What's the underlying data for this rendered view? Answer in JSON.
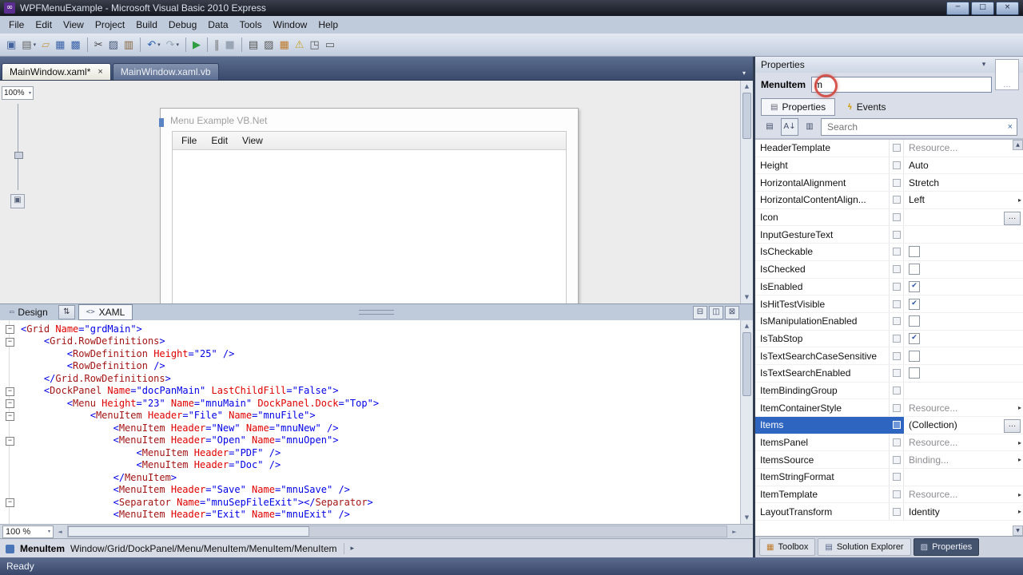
{
  "window": {
    "title": "WPFMenuExample - Microsoft Visual Basic 2010 Express"
  },
  "menu_bar": {
    "items": [
      "File",
      "Edit",
      "View",
      "Project",
      "Build",
      "Debug",
      "Data",
      "Tools",
      "Window",
      "Help"
    ]
  },
  "toolbar": {
    "groups": [
      [
        {
          "name": "new-project",
          "glyph": "▣",
          "color": "#44639E"
        },
        {
          "name": "add-new-item",
          "glyph": "▤",
          "color": "#666666",
          "dropdown": true
        },
        {
          "name": "open-file",
          "glyph": "▱",
          "color": "#C89B4A"
        },
        {
          "name": "save",
          "glyph": "▦",
          "color": "#3A62A8"
        },
        {
          "name": "save-all",
          "glyph": "▩",
          "color": "#3A62A8"
        }
      ],
      [
        {
          "name": "cut",
          "glyph": "✂",
          "color": "#444444"
        },
        {
          "name": "copy",
          "glyph": "▨",
          "color": "#445577"
        },
        {
          "name": "paste",
          "glyph": "▥",
          "color": "#86643C"
        }
      ],
      [
        {
          "name": "undo",
          "glyph": "↶",
          "color": "#2B5FB0",
          "dropdown": true
        },
        {
          "name": "redo",
          "glyph": "↷",
          "color": "#9AAABB",
          "dropdown": true
        }
      ],
      [
        {
          "name": "start-debugging",
          "glyph": "▶",
          "color": "#2E9E40"
        }
      ],
      [
        {
          "name": "break-all",
          "glyph": "‖",
          "color": "#777777"
        },
        {
          "name": "stop-debugging",
          "glyph": "■",
          "color": "#9AA5B5"
        }
      ],
      [
        {
          "name": "solution-explorer",
          "glyph": "▤",
          "color": "#555555"
        },
        {
          "name": "properties-window",
          "glyph": "▨",
          "color": "#555555"
        },
        {
          "name": "toolbox",
          "glyph": "▦",
          "color": "#C07A2A"
        },
        {
          "name": "error-list",
          "glyph": "⚠",
          "color": "#C9A227"
        },
        {
          "name": "object-browser",
          "glyph": "◳",
          "color": "#555555"
        },
        {
          "name": "immediate-window",
          "glyph": "▭",
          "color": "#555555"
        }
      ]
    ]
  },
  "doc_tabs": {
    "tabs": [
      {
        "label": "MainWindow.xaml*",
        "active": true
      },
      {
        "label": "MainWindow.xaml.vb",
        "active": false
      }
    ]
  },
  "designer": {
    "zoom": "100%",
    "window_title": "Menu Example VB.Net",
    "menu_items": [
      "File",
      "Edit",
      "View"
    ]
  },
  "editor_split": {
    "design_tab": "Design",
    "xaml_tab": "XAML"
  },
  "xaml": {
    "zoom": "100 %",
    "lines": [
      {
        "text": "<Grid Name=\"grdMain\">",
        "fold": true
      },
      {
        "text": "    <Grid.RowDefinitions>",
        "fold": true
      },
      {
        "text": "        <RowDefinition Height=\"25\" />"
      },
      {
        "text": "        <RowDefinition />"
      },
      {
        "text": "    </Grid.RowDefinitions>"
      },
      {
        "text": "    <DockPanel Name=\"docPanMain\" LastChildFill=\"False\">",
        "fold": true
      },
      {
        "text": "        <Menu Height=\"23\" Name=\"mnuMain\" DockPanel.Dock=\"Top\">",
        "fold": true
      },
      {
        "text": "            <MenuItem Header=\"File\" Name=\"mnuFile\">",
        "fold": true
      },
      {
        "text": "                <MenuItem Header=\"New\" Name=\"mnuNew\" />"
      },
      {
        "text": "                <MenuItem Header=\"Open\" Name=\"mnuOpen\">",
        "fold": true
      },
      {
        "text": "                    <MenuItem Header=\"PDF\" />"
      },
      {
        "text": "                    <MenuItem Header=\"Doc\" />"
      },
      {
        "text": "                </MenuItem>"
      },
      {
        "text": "                <MenuItem Header=\"Save\" Name=\"mnuSave\" />"
      },
      {
        "text": "                <Separator Name=\"mnuSepFileExit\"></Separator>",
        "fold": true
      },
      {
        "text": "                <MenuItem Header=\"Exit\" Name=\"mnuExit\" />"
      }
    ]
  },
  "properties_panel": {
    "title": "Properties",
    "object_type": "MenuItem",
    "object_name": "m",
    "tabs": [
      "Properties",
      "Events"
    ],
    "search_placeholder": "Search",
    "rows": [
      {
        "name": "HeaderTemplate",
        "value": "Resource...",
        "muted": true,
        "arrow": true
      },
      {
        "name": "Height",
        "value": "Auto"
      },
      {
        "name": "HorizontalAlignment",
        "value": "Stretch"
      },
      {
        "name": "HorizontalContentAlign...",
        "value": "Left",
        "arrow": true
      },
      {
        "name": "Icon",
        "ellipsis": true
      },
      {
        "name": "InputGestureText"
      },
      {
        "name": "IsCheckable",
        "checkbox": true,
        "checked": false
      },
      {
        "name": "IsChecked",
        "checkbox": true,
        "checked": false
      },
      {
        "name": "IsEnabled",
        "checkbox": true,
        "checked": true
      },
      {
        "name": "IsHitTestVisible",
        "checkbox": true,
        "checked": true
      },
      {
        "name": "IsManipulationEnabled",
        "checkbox": true,
        "checked": false
      },
      {
        "name": "IsTabStop",
        "checkbox": true,
        "checked": true
      },
      {
        "name": "IsTextSearchCaseSensitive",
        "checkbox": true,
        "checked": false
      },
      {
        "name": "IsTextSearchEnabled",
        "checkbox": true,
        "checked": false
      },
      {
        "name": "ItemBindingGroup"
      },
      {
        "name": "ItemContainerStyle",
        "value": "Resource...",
        "muted": true,
        "arrow": true
      },
      {
        "name": "Items",
        "value": "(Collection)",
        "selected": true,
        "ellipsis": true
      },
      {
        "name": "ItemsPanel",
        "value": "Resource...",
        "muted": true,
        "arrow": true
      },
      {
        "name": "ItemsSource",
        "value": "Binding...",
        "muted": true,
        "arrow": true
      },
      {
        "name": "ItemStringFormat"
      },
      {
        "name": "ItemTemplate",
        "value": "Resource...",
        "muted": true,
        "arrow": true
      },
      {
        "name": "LayoutTransform",
        "value": "Identity",
        "arrow": true
      }
    ]
  },
  "breadcrumb": {
    "object": "MenuItem",
    "path": "Window/Grid/DockPanel/Menu/MenuItem/MenuItem/MenuItem"
  },
  "panel_tabs": [
    {
      "label": "Toolbox",
      "icon": "▦",
      "color": "#C07A2A",
      "selected": false
    },
    {
      "label": "Solution Explorer",
      "icon": "▤",
      "color": "#55648A",
      "selected": false
    },
    {
      "label": "Properties",
      "icon": "▨",
      "color": "#C8D2E4",
      "selected": true
    }
  ],
  "status_bar": {
    "text": "Ready"
  },
  "icons": {
    "app_logo": "∞",
    "minimize": "─",
    "maximize": "□",
    "close": "×",
    "dropdown": "▾",
    "tab_close": "×",
    "swap_panes": "⇅",
    "split_h": "⊟",
    "split_v": "◫",
    "split_close": "⊠",
    "scroll_up": "▲",
    "scroll_down": "▼",
    "scroll_left": "◄",
    "scroll_right": "►",
    "search_clear": "×",
    "chevron_right": "▸",
    "events": "ϟ",
    "properties_tab": "▤",
    "design_tab": "▭",
    "xaml_tab": "<>",
    "fit_zoom": "▣",
    "categorized": "▤",
    "sort_az": "A↓",
    "filter": "▥",
    "ellipsis": "…"
  },
  "colors": {
    "selection": "#2E65C0",
    "xml_element": "#A31515",
    "xml_attribute": "#E00000",
    "xml_value": "#0000E6",
    "debug_play": "#2E9E40",
    "annotation_circle": "#D0453C"
  }
}
